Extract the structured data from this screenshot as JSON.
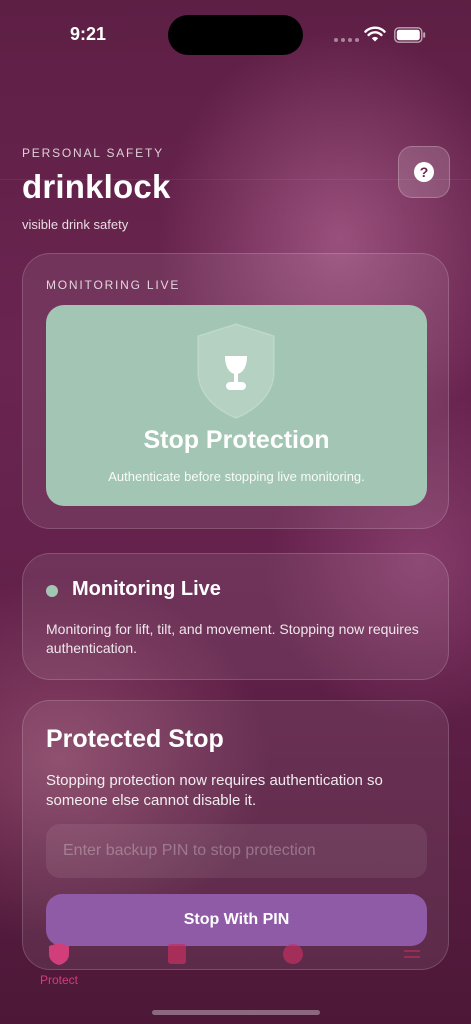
{
  "status_bar": {
    "time": "9:21"
  },
  "header": {
    "eyebrow": "PERSONAL SAFETY",
    "title": "drinklock",
    "tagline": "visible drink safety"
  },
  "monitor_card": {
    "label": "MONITORING LIVE",
    "stop_title": "Stop Protection",
    "stop_subtitle": "Authenticate before stopping live monitoring."
  },
  "status_card": {
    "title": "Monitoring Live",
    "description": "Monitoring for lift, tilt, and movement. Stopping now requires authentication."
  },
  "pin_card": {
    "title": "Protected Stop",
    "description": "Stopping protection now requires authentication so someone else cannot disable it.",
    "input_value": "",
    "input_placeholder": "Enter backup PIN to stop protection",
    "button_label": "Stop With PIN"
  },
  "tab_bar": {
    "active_tab": "Protect",
    "tabs": [
      {
        "label": "Protect",
        "icon": "shield-icon"
      },
      {
        "label": "",
        "icon": "log-icon"
      },
      {
        "label": "",
        "icon": "contacts-icon"
      },
      {
        "label": "",
        "icon": "settings-icon"
      }
    ]
  },
  "colors": {
    "accent_green": "#a2c6b3",
    "button_purple": "#8f5aa6",
    "tab_active": "#d23e7a",
    "background": "#62214a"
  }
}
